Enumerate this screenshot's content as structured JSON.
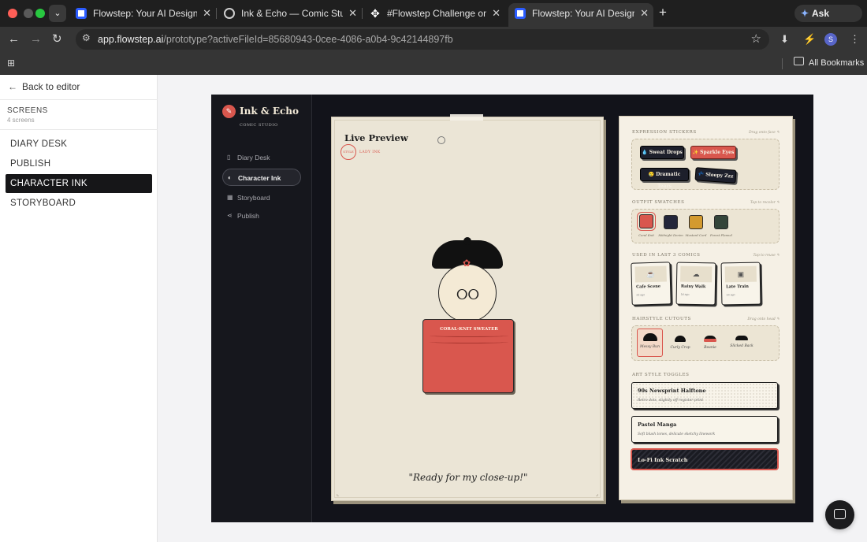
{
  "browser": {
    "tabs": [
      {
        "label": "Flowstep: Your AI Design Ass",
        "favicon": "flowstep-icon",
        "active": false
      },
      {
        "label": "Ink & Echo — Comic Studio P",
        "favicon": "globe-icon",
        "active": false
      },
      {
        "label": "#Flowstep Challenge on Con",
        "favicon": "compass-icon",
        "active": false
      },
      {
        "label": "Flowstep: Your AI Design Ass",
        "favicon": "flowstep-icon",
        "active": true
      }
    ],
    "ask_gemini": "Ask Gemini",
    "url_host": "app.flowstep.ai",
    "url_path": "/prototype?activeFileId=85680943-0cee-4086-a0b4-9c42144897fb",
    "profile_initial": "S",
    "bookmarks_label": "All Bookmarks"
  },
  "sidebar": {
    "back_label": "Back to editor",
    "screens_heading": "SCREENS",
    "screens_count": "4 screens",
    "screens": [
      "DIARY DESK",
      "PUBLISH",
      "CHARACTER INK",
      "STORYBOARD"
    ],
    "selected_index": 2
  },
  "app": {
    "brand": "Ink & Echo",
    "brand_sub": "COMIC STUDIO",
    "nav": [
      {
        "label": "Diary Desk",
        "icon": "book-icon"
      },
      {
        "label": "Character Ink",
        "icon": "palette-icon",
        "selected": true
      },
      {
        "label": "Storyboard",
        "icon": "grid-icon"
      },
      {
        "label": "Publish",
        "icon": "share-icon"
      }
    ],
    "preview": {
      "title": "Live Preview",
      "stamp": "STYLE",
      "stamp_text": "LADY INK",
      "sweater_label": "CORAL-KNIT SWEATER",
      "quote": "\"Ready for my close-up!\""
    },
    "panel": {
      "stickers": {
        "title": "EXPRESSION STICKERS",
        "hint": "Drag onto face ✎",
        "items": [
          "💧 Sweat Drops",
          "✨ Sparkle Eyes",
          "😢 Dramatic Tears",
          "💤 Sleepy Zzz"
        ]
      },
      "swatches": {
        "title": "OUTFIT SWATCHES",
        "hint": "Tap to recolor ✎",
        "items": [
          {
            "name": "Coral Knit",
            "color": "#d9574e"
          },
          {
            "name": "Midnight Denim",
            "color": "#23263a"
          },
          {
            "name": "Mustard Cord",
            "color": "#d39a2f"
          },
          {
            "name": "Forest Flannel",
            "color": "#34453a"
          }
        ]
      },
      "recent": {
        "title": "USED IN LAST 3 COMICS",
        "hint": "Tap to reuse ✎",
        "items": [
          {
            "name": "Cafe Scene",
            "ago": "2d ago",
            "icon": "cup-icon"
          },
          {
            "name": "Rainy Walk",
            "ago": "5d ago",
            "icon": "cloud-icon"
          },
          {
            "name": "Late Train",
            "ago": "1w ago",
            "icon": "train-icon"
          }
        ]
      },
      "hairstyles": {
        "title": "HAIRSTYLE CUTOUTS",
        "hint": "Drag onto head ✎",
        "items": [
          "Messy Bun",
          "Curly Crop",
          "Beanie",
          "Slicked Back"
        ]
      },
      "toggles": {
        "title": "ART STYLE TOGGLES",
        "items": [
          {
            "name": "90s Newsprint Halftone",
            "desc": "Retro dots, slightly off-register print"
          },
          {
            "name": "Pastel Manga",
            "desc": "Soft blush tones, delicate sketchy linework"
          },
          {
            "name": "Lo-Fi Ink Scratch",
            "desc": ""
          }
        ]
      }
    }
  }
}
